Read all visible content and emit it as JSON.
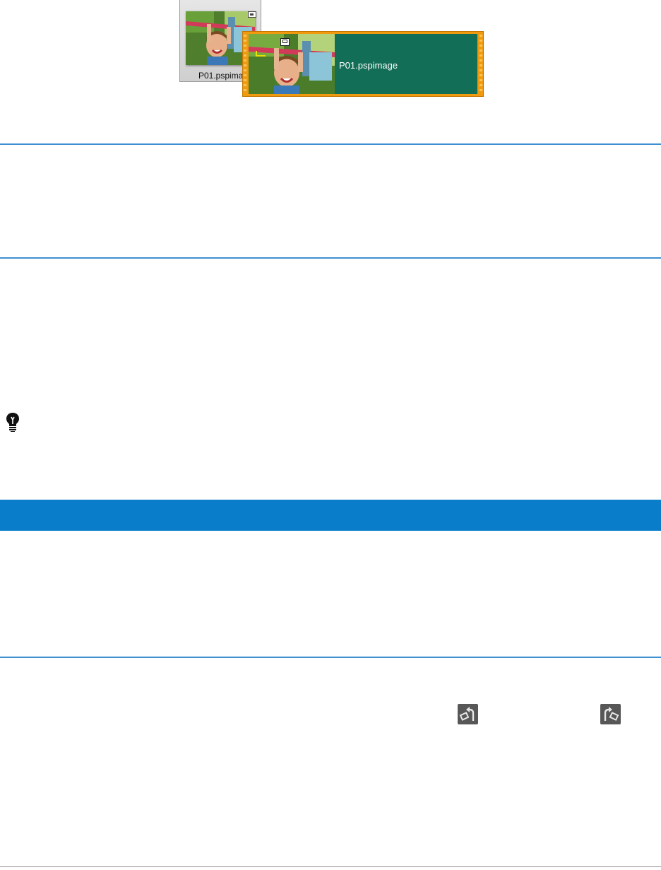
{
  "figure": {
    "library_thumbnail": {
      "label": "P01.pspimage"
    },
    "timeline_clip": {
      "label": "P01.pspimage"
    }
  },
  "colors": {
    "rule": "#3d8fd1",
    "section_band": "#0a7dca",
    "clip_border": "#f09a10",
    "clip_body": "#136e57"
  },
  "icons": {
    "tip": "lightbulb-icon",
    "rotate_left": "rotate-left-icon",
    "rotate_right": "rotate-right-icon"
  }
}
